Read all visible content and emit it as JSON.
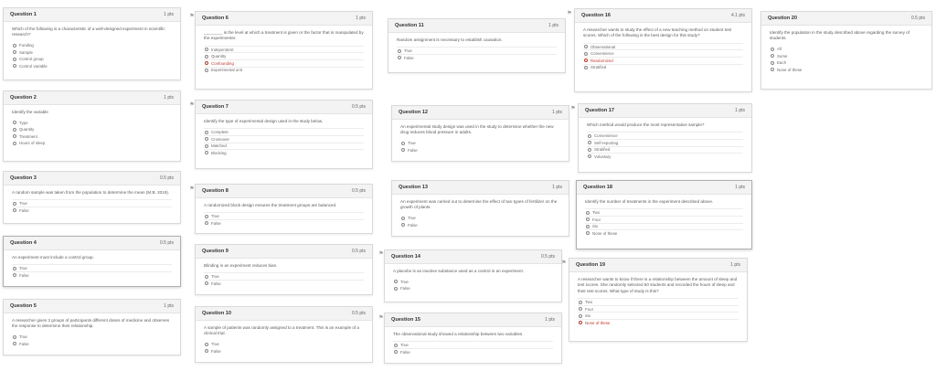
{
  "questions": [
    {
      "id": "q1",
      "title": "Question 1",
      "points": "1 pts",
      "text": "Which of the following is a characteristic of a well-designed experiment in scientific research?",
      "options": [
        {
          "label": "Funding"
        },
        {
          "label": "Sample"
        },
        {
          "label": "Control group"
        },
        {
          "label": "Control variable"
        }
      ]
    },
    {
      "id": "q2",
      "title": "Question 2",
      "points": "1 pts",
      "text": "Identify the variable",
      "options": [
        {
          "label": "Type"
        },
        {
          "label": "Quantity"
        },
        {
          "label": "Treatment"
        },
        {
          "label": "Hours of sleep"
        }
      ]
    },
    {
      "id": "q3",
      "title": "Question 3",
      "points": "0.5 pts",
      "text": "A random sample was taken from the population to determine the mean (M.B. 2019).",
      "options": [
        {
          "label": "True"
        },
        {
          "label": "False"
        }
      ]
    },
    {
      "id": "q4",
      "title": "Question 4",
      "points": "0.5 pts",
      "text": "An experiment must include a control group.",
      "options": [
        {
          "label": "True"
        },
        {
          "label": "False"
        }
      ]
    },
    {
      "id": "q5",
      "title": "Question 5",
      "points": "1 pts",
      "text": "A researcher gives 3 groups of participants different doses of medicine and observes the response to determine their relationship.",
      "options": [
        {
          "label": "True"
        },
        {
          "label": "False"
        }
      ]
    },
    {
      "id": "q6",
      "title": "Question 6",
      "points": "1 pts",
      "text": "________ is the level at which a treatment is given or the factor that is manipulated by the experimenter.",
      "options": [
        {
          "label": "Independent"
        },
        {
          "label": "Quantity"
        },
        {
          "label": "Confounding",
          "sel": true
        },
        {
          "label": "Experimental unit"
        }
      ]
    },
    {
      "id": "q7",
      "title": "Question 7",
      "points": "0.5 pts",
      "text": "Identify the type of experimental design used in the study below.",
      "options": [
        {
          "label": "Complete"
        },
        {
          "label": "Crossover"
        },
        {
          "label": "Matched"
        },
        {
          "label": "Blocking"
        }
      ]
    },
    {
      "id": "q8",
      "title": "Question 8",
      "points": "0.5 pts",
      "text": "A randomized block design ensures the treatment groups are balanced.",
      "options": [
        {
          "label": "True"
        },
        {
          "label": "False"
        }
      ]
    },
    {
      "id": "q9",
      "title": "Question 9",
      "points": "0.5 pts",
      "text": "Blinding in an experiment reduces bias.",
      "options": [
        {
          "label": "True"
        },
        {
          "label": "False"
        }
      ]
    },
    {
      "id": "q10",
      "title": "Question 10",
      "points": "0.5 pts",
      "text": "A sample of patients was randomly assigned to a treatment. This is an example of a clinical trial.",
      "options": [
        {
          "label": "True"
        },
        {
          "label": "False"
        }
      ]
    },
    {
      "id": "q11",
      "title": "Question 11",
      "points": "1 pts",
      "text": "Random assignment is necessary to establish causation.",
      "options": [
        {
          "label": "True"
        },
        {
          "label": "False"
        }
      ]
    },
    {
      "id": "q12",
      "title": "Question 12",
      "points": "1 pts",
      "text": "An experimental study design was used in the study to determine whether the new drug reduces blood pressure in adults.",
      "options": [
        {
          "label": "True"
        },
        {
          "label": "False"
        }
      ]
    },
    {
      "id": "q13",
      "title": "Question 13",
      "points": "1 pts",
      "text": "An experiment was carried out to determine the effect of two types of fertilizer on the growth of plants.",
      "options": [
        {
          "label": "True"
        },
        {
          "label": "False"
        }
      ]
    },
    {
      "id": "q14",
      "title": "Question 14",
      "points": "0.5 pts",
      "text": "A placebo is an inactive substance used as a control in an experiment.",
      "options": [
        {
          "label": "True"
        },
        {
          "label": "False"
        }
      ]
    },
    {
      "id": "q15",
      "title": "Question 15",
      "points": "1 pts",
      "text": "The observational study showed a relationship between two variables.",
      "options": [
        {
          "label": "True"
        },
        {
          "label": "False"
        }
      ]
    },
    {
      "id": "q16",
      "title": "Question 16",
      "points": "4.1 pts",
      "text": "A researcher wants to study the effect of a new teaching method on student test scores. Which of the following is the best design for this study?",
      "options": [
        {
          "label": "Observational"
        },
        {
          "label": "Convenience"
        },
        {
          "label": "Randomized",
          "sel": true
        },
        {
          "label": "Stratified"
        }
      ]
    },
    {
      "id": "q17",
      "title": "Question 17",
      "points": "1 pts",
      "text": "Which method would produce the most representative sample?",
      "options": [
        {
          "label": "Convenience"
        },
        {
          "label": "Self-reporting"
        },
        {
          "label": "Stratified"
        },
        {
          "label": "Voluntary"
        }
      ]
    },
    {
      "id": "q18",
      "title": "Question 18",
      "points": "1 pts",
      "text": "Identify the number of treatments in the experiment described above.",
      "options": [
        {
          "label": "Two"
        },
        {
          "label": "Four"
        },
        {
          "label": "Six"
        },
        {
          "label": "None of these"
        }
      ]
    },
    {
      "id": "q19",
      "title": "Question 19",
      "points": "1 pts",
      "text": "A researcher wants to know if there is a relationship between the amount of sleep and test scores. She randomly selected 50 students and recorded the hours of sleep and their test scores. What type of study is this?",
      "options": [
        {
          "label": "Two"
        },
        {
          "label": "Four"
        },
        {
          "label": "Six"
        },
        {
          "label": "None of these",
          "sel": true
        }
      ]
    },
    {
      "id": "q20",
      "title": "Question 20",
      "points": "0.5 pts",
      "text": "Identify the population in the study described above regarding the survey of students.",
      "options": [
        {
          "label": "All"
        },
        {
          "label": "Some"
        },
        {
          "label": "Each"
        },
        {
          "label": "None of these"
        }
      ]
    }
  ],
  "colors": {
    "selected": "#c0392b",
    "header_bg": "#f3f3f3",
    "border": "#d9d9d9"
  },
  "icons": {
    "flag": "flag-icon"
  }
}
